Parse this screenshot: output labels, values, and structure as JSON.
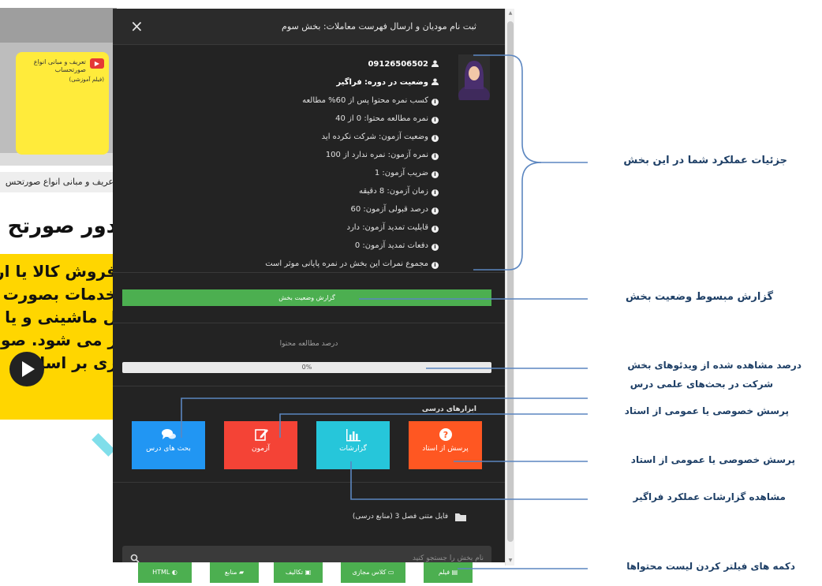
{
  "background_page": {
    "card_text": "تعریف و مبانی انواع صورتحساب",
    "card_subtitle": "(فیلم آموزشی)",
    "strip_text": "عریف و مبانی انواع صورتحس",
    "heading": "دور صورتح",
    "lines": [
      "فروش کالا یا ار",
      "خدمات بصورت",
      "ل ماشینی و یا تر",
      "ر می شود. صو",
      "ری بر اساس"
    ]
  },
  "modal": {
    "close_label": "×",
    "title": "ثبت نام مودیان و ارسال فهرست معاملات: بخش سوم",
    "phone": "09126506502",
    "status_label": "وضعیت در دوره:",
    "status_value": "فراگیر",
    "info": [
      "کسب نمره محتوا پس از 60% مطالعه",
      "نمره مطالعه محتوا: 0 از 40",
      "وضعیت آزمون: شرکت نکرده اید",
      "نمره آزمون: نمره ندارد از 100",
      "ضریب آزمون: 1",
      "زمان آزمون: 8 دقیقه",
      "درصد قبولی آزمون: 60",
      "قابلیت تمدید آزمون: دارد",
      "دفعات تمدید آزمون: 0",
      "مجموع نمرات این بخش در نمره پایانی موثر است"
    ],
    "report_button": "گزارش وضعیت بخش",
    "progress_label": "درصد مطالعه محتوا",
    "progress_text": "0%",
    "progress_value": 0,
    "tools_label": "ابزارهای درسی",
    "tools": [
      {
        "label": "پرسش از استاد",
        "color": "#ff5722",
        "icon": "question-icon"
      },
      {
        "label": "گزارشات",
        "color": "#26c6da",
        "icon": "bar-chart-icon"
      },
      {
        "label": "آزمون",
        "color": "#f44336",
        "icon": "edit-icon"
      },
      {
        "label": "بحث های درس",
        "color": "#2196f3",
        "icon": "comments-icon"
      }
    ],
    "search_placeholder": "نام بخش را جستجو کنید",
    "file_label": "فایل متنی فصل 3 (منابع درسی)",
    "filters": [
      "فیلم",
      "کلاس مجازی",
      "تکالیف",
      "منابع",
      "HTML"
    ]
  },
  "annotations": [
    "جزئیات عملکرد شما در این بخش",
    "گزارش مبسوط وضعیت بخش",
    "درصد مشاهده شده از ویدئوهای بخش",
    "شرکت در بحث‌های علمی درس",
    "پرسش خصوصی یا عمومی از استاد",
    "پرسش خصوصی یا عمومی از استاد",
    "مشاهده گزارشات عملکرد فراگیر",
    "دکمه های فیلتر کردن لیست محتواها"
  ],
  "colors": {
    "modal_bg": "#232323",
    "success": "#4caf50",
    "annotation": "#1e3f66",
    "annotation_line": "#5b86c0"
  }
}
